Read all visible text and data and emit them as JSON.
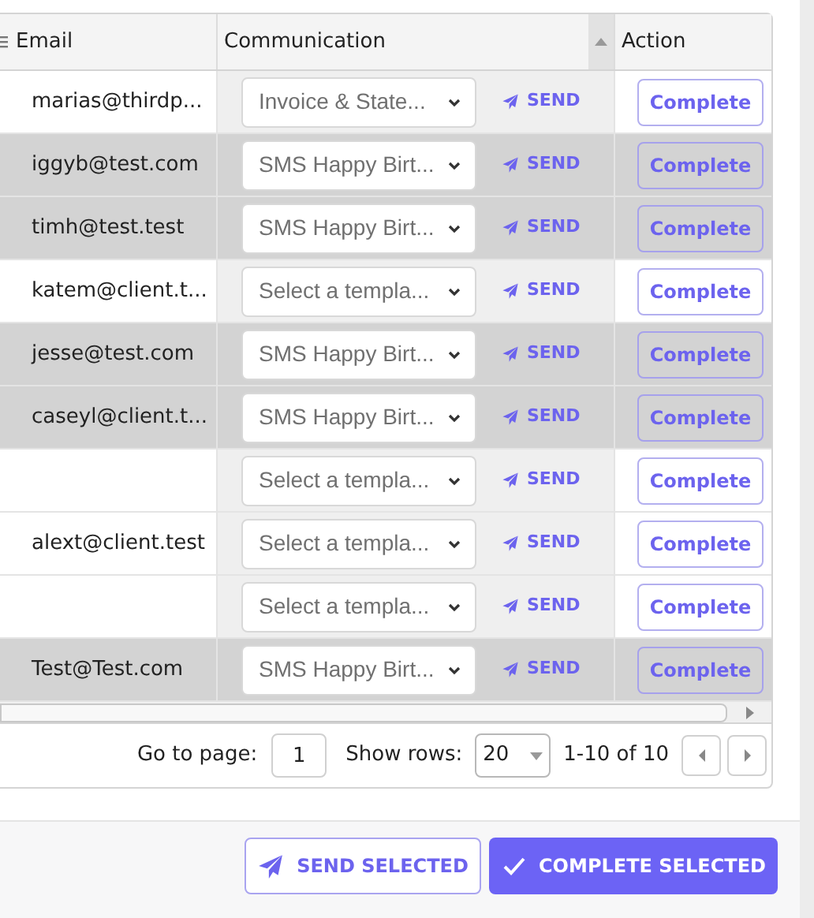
{
  "table": {
    "columns": [
      {
        "label": "Email",
        "sorted": false
      },
      {
        "label": "Communication",
        "sorted": true
      },
      {
        "label": "Action",
        "sorted": false
      }
    ],
    "rows": [
      {
        "email": "marias@thirdp...",
        "template": "Invoice & State...",
        "send": "SEND",
        "action": "Complete",
        "selected": false
      },
      {
        "email": "iggyb@test.com",
        "template": "SMS Happy Birt...",
        "send": "SEND",
        "action": "Complete",
        "selected": true
      },
      {
        "email": "timh@test.test",
        "template": "SMS Happy Birt...",
        "send": "SEND",
        "action": "Complete",
        "selected": true
      },
      {
        "email": "katem@client.t...",
        "template": "Select a templa...",
        "send": "SEND",
        "action": "Complete",
        "selected": false
      },
      {
        "email": "jesse@test.com",
        "template": "SMS Happy Birt...",
        "send": "SEND",
        "action": "Complete",
        "selected": true
      },
      {
        "email": "caseyl@client.t...",
        "template": "SMS Happy Birt...",
        "send": "SEND",
        "action": "Complete",
        "selected": true
      },
      {
        "template": "Select a templa...",
        "send": "SEND",
        "action": "Complete",
        "selected": false
      },
      {
        "email": "alext@client.test",
        "template": "Select a templa...",
        "send": "SEND",
        "action": "Complete",
        "selected": false
      },
      {
        "template": "Select a templa...",
        "send": "SEND",
        "action": "Complete",
        "selected": false
      },
      {
        "email": "Test@Test.com",
        "template": "SMS Happy Birt...",
        "send": "SEND",
        "action": "Complete",
        "selected": true
      }
    ]
  },
  "pagination": {
    "goto_label": "Go to page:",
    "page": "1",
    "rows_label": "Show rows:",
    "rows_per_page": "20",
    "range": "1-10 of 10"
  },
  "footer": {
    "buttons": [
      {
        "label": "SEND SELECTED",
        "kind": "outline"
      },
      {
        "label": "COMPLETE SELECTED",
        "kind": "primary"
      }
    ]
  }
}
